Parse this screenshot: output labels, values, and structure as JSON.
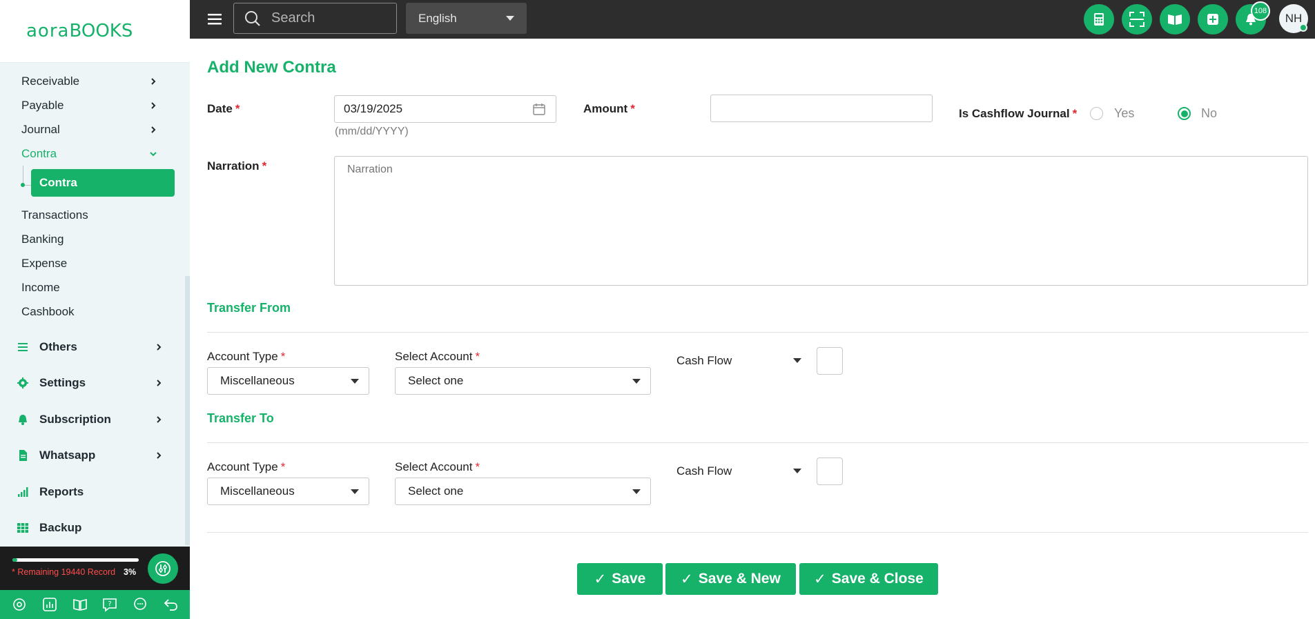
{
  "app": {
    "logo_left": "aora",
    "logo_right": "BOOKS"
  },
  "sidebar": {
    "sub_items": [
      {
        "label": "Receivable"
      },
      {
        "label": "Payable"
      },
      {
        "label": "Journal"
      },
      {
        "label": "Contra"
      }
    ],
    "active_leaf": "Contra",
    "plain_items": [
      {
        "label": "Transactions"
      },
      {
        "label": "Banking"
      },
      {
        "label": "Expense"
      },
      {
        "label": "Income"
      },
      {
        "label": "Cashbook"
      }
    ],
    "sections": [
      {
        "label": "Others",
        "icon": "list-icon"
      },
      {
        "label": "Settings",
        "icon": "gear-icon"
      },
      {
        "label": "Subscription",
        "icon": "bell-icon"
      },
      {
        "label": "Whatsapp",
        "icon": "document-icon"
      },
      {
        "label": "Reports",
        "icon": "bar-signal-icon"
      },
      {
        "label": "Backup",
        "icon": "grid-icon"
      }
    ],
    "record": {
      "text": "* Remaining 19440 Record",
      "percent": "3%",
      "progress_fraction": 0.03
    },
    "footer_icons": [
      "settings-icon",
      "chart-icon",
      "book-icon",
      "help-icon",
      "chat-icon",
      "back-icon"
    ]
  },
  "topbar": {
    "search_placeholder": "Search",
    "language": "English",
    "notification_count": "108",
    "avatar_initials": "NH",
    "icons": [
      "calculator-icon",
      "scan-icon",
      "book-open-icon",
      "add-icon",
      "bell-icon"
    ]
  },
  "form": {
    "title": "Add New Contra",
    "date_label": "Date",
    "date_value": "03/19/2025",
    "date_hint": "(mm/dd/YYYY)",
    "amount_label": "Amount",
    "amount_value": "",
    "cashflow_journal_label": "Is Cashflow Journal",
    "yes_label": "Yes",
    "no_label": "No",
    "cashflow_journal_selected": "No",
    "narration_label": "Narration",
    "narration_placeholder": "Narration",
    "transfer_from": {
      "title": "Transfer From",
      "account_type_label": "Account Type",
      "account_type_value": "Miscellaneous",
      "select_account_label": "Select Account",
      "select_account_value": "Select one",
      "cash_flow_label": "Cash Flow"
    },
    "transfer_to": {
      "title": "Transfer To",
      "account_type_label": "Account Type",
      "account_type_value": "Miscellaneous",
      "select_account_label": "Select Account",
      "select_account_value": "Select one",
      "cash_flow_label": "Cash Flow"
    },
    "buttons": {
      "save": "Save",
      "save_new": "Save & New",
      "save_close": "Save & Close",
      "check": "✓"
    },
    "required_mark": "*"
  },
  "colors": {
    "accent": "#16b26a",
    "topbar": "#2d2d2d",
    "required": "#e0272f"
  }
}
